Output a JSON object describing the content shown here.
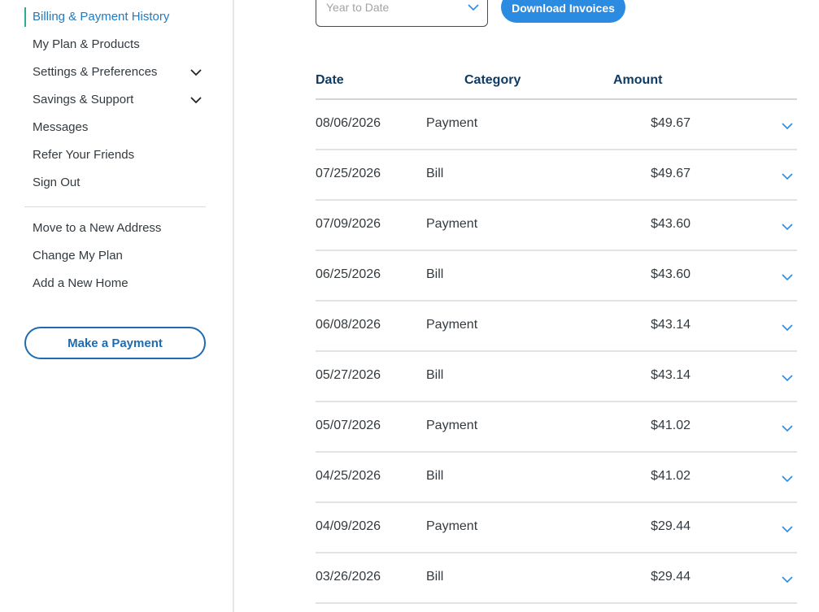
{
  "sidebar": {
    "items": [
      {
        "label": "Billing & Payment History",
        "active": true
      },
      {
        "label": "My Plan & Products"
      },
      {
        "label": "Settings & Preferences",
        "expandable": true
      },
      {
        "label": "Savings & Support",
        "expandable": true
      },
      {
        "label": "Messages"
      },
      {
        "label": "Refer Your Friends"
      },
      {
        "label": "Sign Out"
      }
    ],
    "secondary_items": [
      {
        "label": "Move to a New Address"
      },
      {
        "label": "Change My Plan"
      },
      {
        "label": "Add a New Home"
      }
    ],
    "make_payment_label": "Make a Payment"
  },
  "filters": {
    "period_select_value": "Year to Date",
    "download_label": "Download Invoices"
  },
  "table": {
    "headers": {
      "date": "Date",
      "category": "Category",
      "amount": "Amount"
    },
    "rows": [
      {
        "date": "08/06/2026",
        "category": "Payment",
        "amount": "$49.67"
      },
      {
        "date": "07/25/2026",
        "category": "Bill",
        "amount": "$49.67"
      },
      {
        "date": "07/09/2026",
        "category": "Payment",
        "amount": "$43.60"
      },
      {
        "date": "06/25/2026",
        "category": "Bill",
        "amount": "$43.60"
      },
      {
        "date": "06/08/2026",
        "category": "Payment",
        "amount": "$43.14"
      },
      {
        "date": "05/27/2026",
        "category": "Bill",
        "amount": "$43.14"
      },
      {
        "date": "05/07/2026",
        "category": "Payment",
        "amount": "$41.02"
      },
      {
        "date": "04/25/2026",
        "category": "Bill",
        "amount": "$41.02"
      },
      {
        "date": "04/09/2026",
        "category": "Payment",
        "amount": "$29.44"
      },
      {
        "date": "03/26/2026",
        "category": "Bill",
        "amount": "$29.44"
      }
    ]
  },
  "colors": {
    "accent_blue": "#2b8be0",
    "link_blue": "#1f7ac0",
    "header_navy": "#0f3b63",
    "active_indicator": "#2fae8f"
  }
}
